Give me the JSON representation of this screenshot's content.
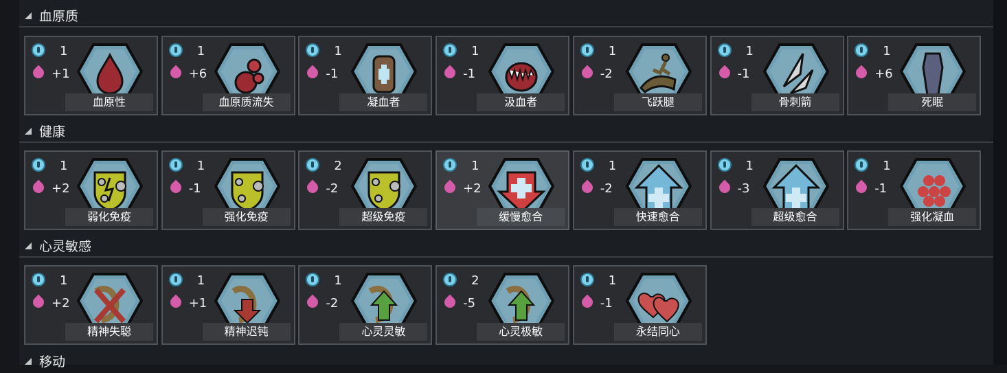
{
  "sections": [
    {
      "title": "血原质",
      "cards": [
        {
          "name": "血原性",
          "power": "1",
          "effect": "+1",
          "icon": "blood-drop-icon"
        },
        {
          "name": "血原质流失",
          "power": "1",
          "effect": "+6",
          "icon": "blood-loss-icon"
        },
        {
          "name": "凝血者",
          "power": "1",
          "effect": "-1",
          "icon": "coagulator-glove-icon"
        },
        {
          "name": "汲血者",
          "power": "1",
          "effect": "-1",
          "icon": "fangs-icon"
        },
        {
          "name": "飞跃腿",
          "power": "1",
          "effect": "-2",
          "icon": "leaping-legs-icon"
        },
        {
          "name": "骨刺箭",
          "power": "1",
          "effect": "-1",
          "icon": "bone-spikes-icon"
        },
        {
          "name": "死眠",
          "power": "1",
          "effect": "+6",
          "icon": "coffin-icon"
        }
      ]
    },
    {
      "title": "健康",
      "cards": [
        {
          "name": "弱化免疫",
          "power": "1",
          "effect": "+2",
          "icon": "weak-immunity-icon"
        },
        {
          "name": "强化免疫",
          "power": "1",
          "effect": "-1",
          "icon": "strong-immunity-icon"
        },
        {
          "name": "超级免疫",
          "power": "2",
          "effect": "-2",
          "icon": "super-immunity-icon"
        },
        {
          "name": "缓慢愈合",
          "power": "1",
          "effect": "+2",
          "icon": "slow-healing-icon"
        },
        {
          "name": "快速愈合",
          "power": "1",
          "effect": "-2",
          "icon": "fast-healing-icon"
        },
        {
          "name": "超级愈合",
          "power": "1",
          "effect": "-3",
          "icon": "super-healing-icon"
        },
        {
          "name": "强化凝血",
          "power": "1",
          "effect": "-1",
          "icon": "strong-clotting-icon"
        }
      ]
    },
    {
      "title": "心灵敏感",
      "cards": [
        {
          "name": "精神失聪",
          "power": "1",
          "effect": "+2",
          "icon": "psychically-deaf-icon"
        },
        {
          "name": "精神迟钝",
          "power": "1",
          "effect": "+1",
          "icon": "psychically-dull-icon"
        },
        {
          "name": "心灵灵敏",
          "power": "1",
          "effect": "-2",
          "icon": "psychically-sensitive-icon"
        },
        {
          "name": "心灵极敏",
          "power": "2",
          "effect": "-5",
          "icon": "psychically-hypersensitive-icon"
        },
        {
          "name": "永结同心",
          "power": "1",
          "effect": "-1",
          "icon": "hearts-icon"
        }
      ]
    },
    {
      "title": "移动",
      "cards": []
    }
  ],
  "colors": {
    "hex_fill": "#6f9fb3",
    "hex_border": "#0d0d0d",
    "power_icon": "#7fd0ea",
    "drop_icon": "#d45ca8"
  }
}
